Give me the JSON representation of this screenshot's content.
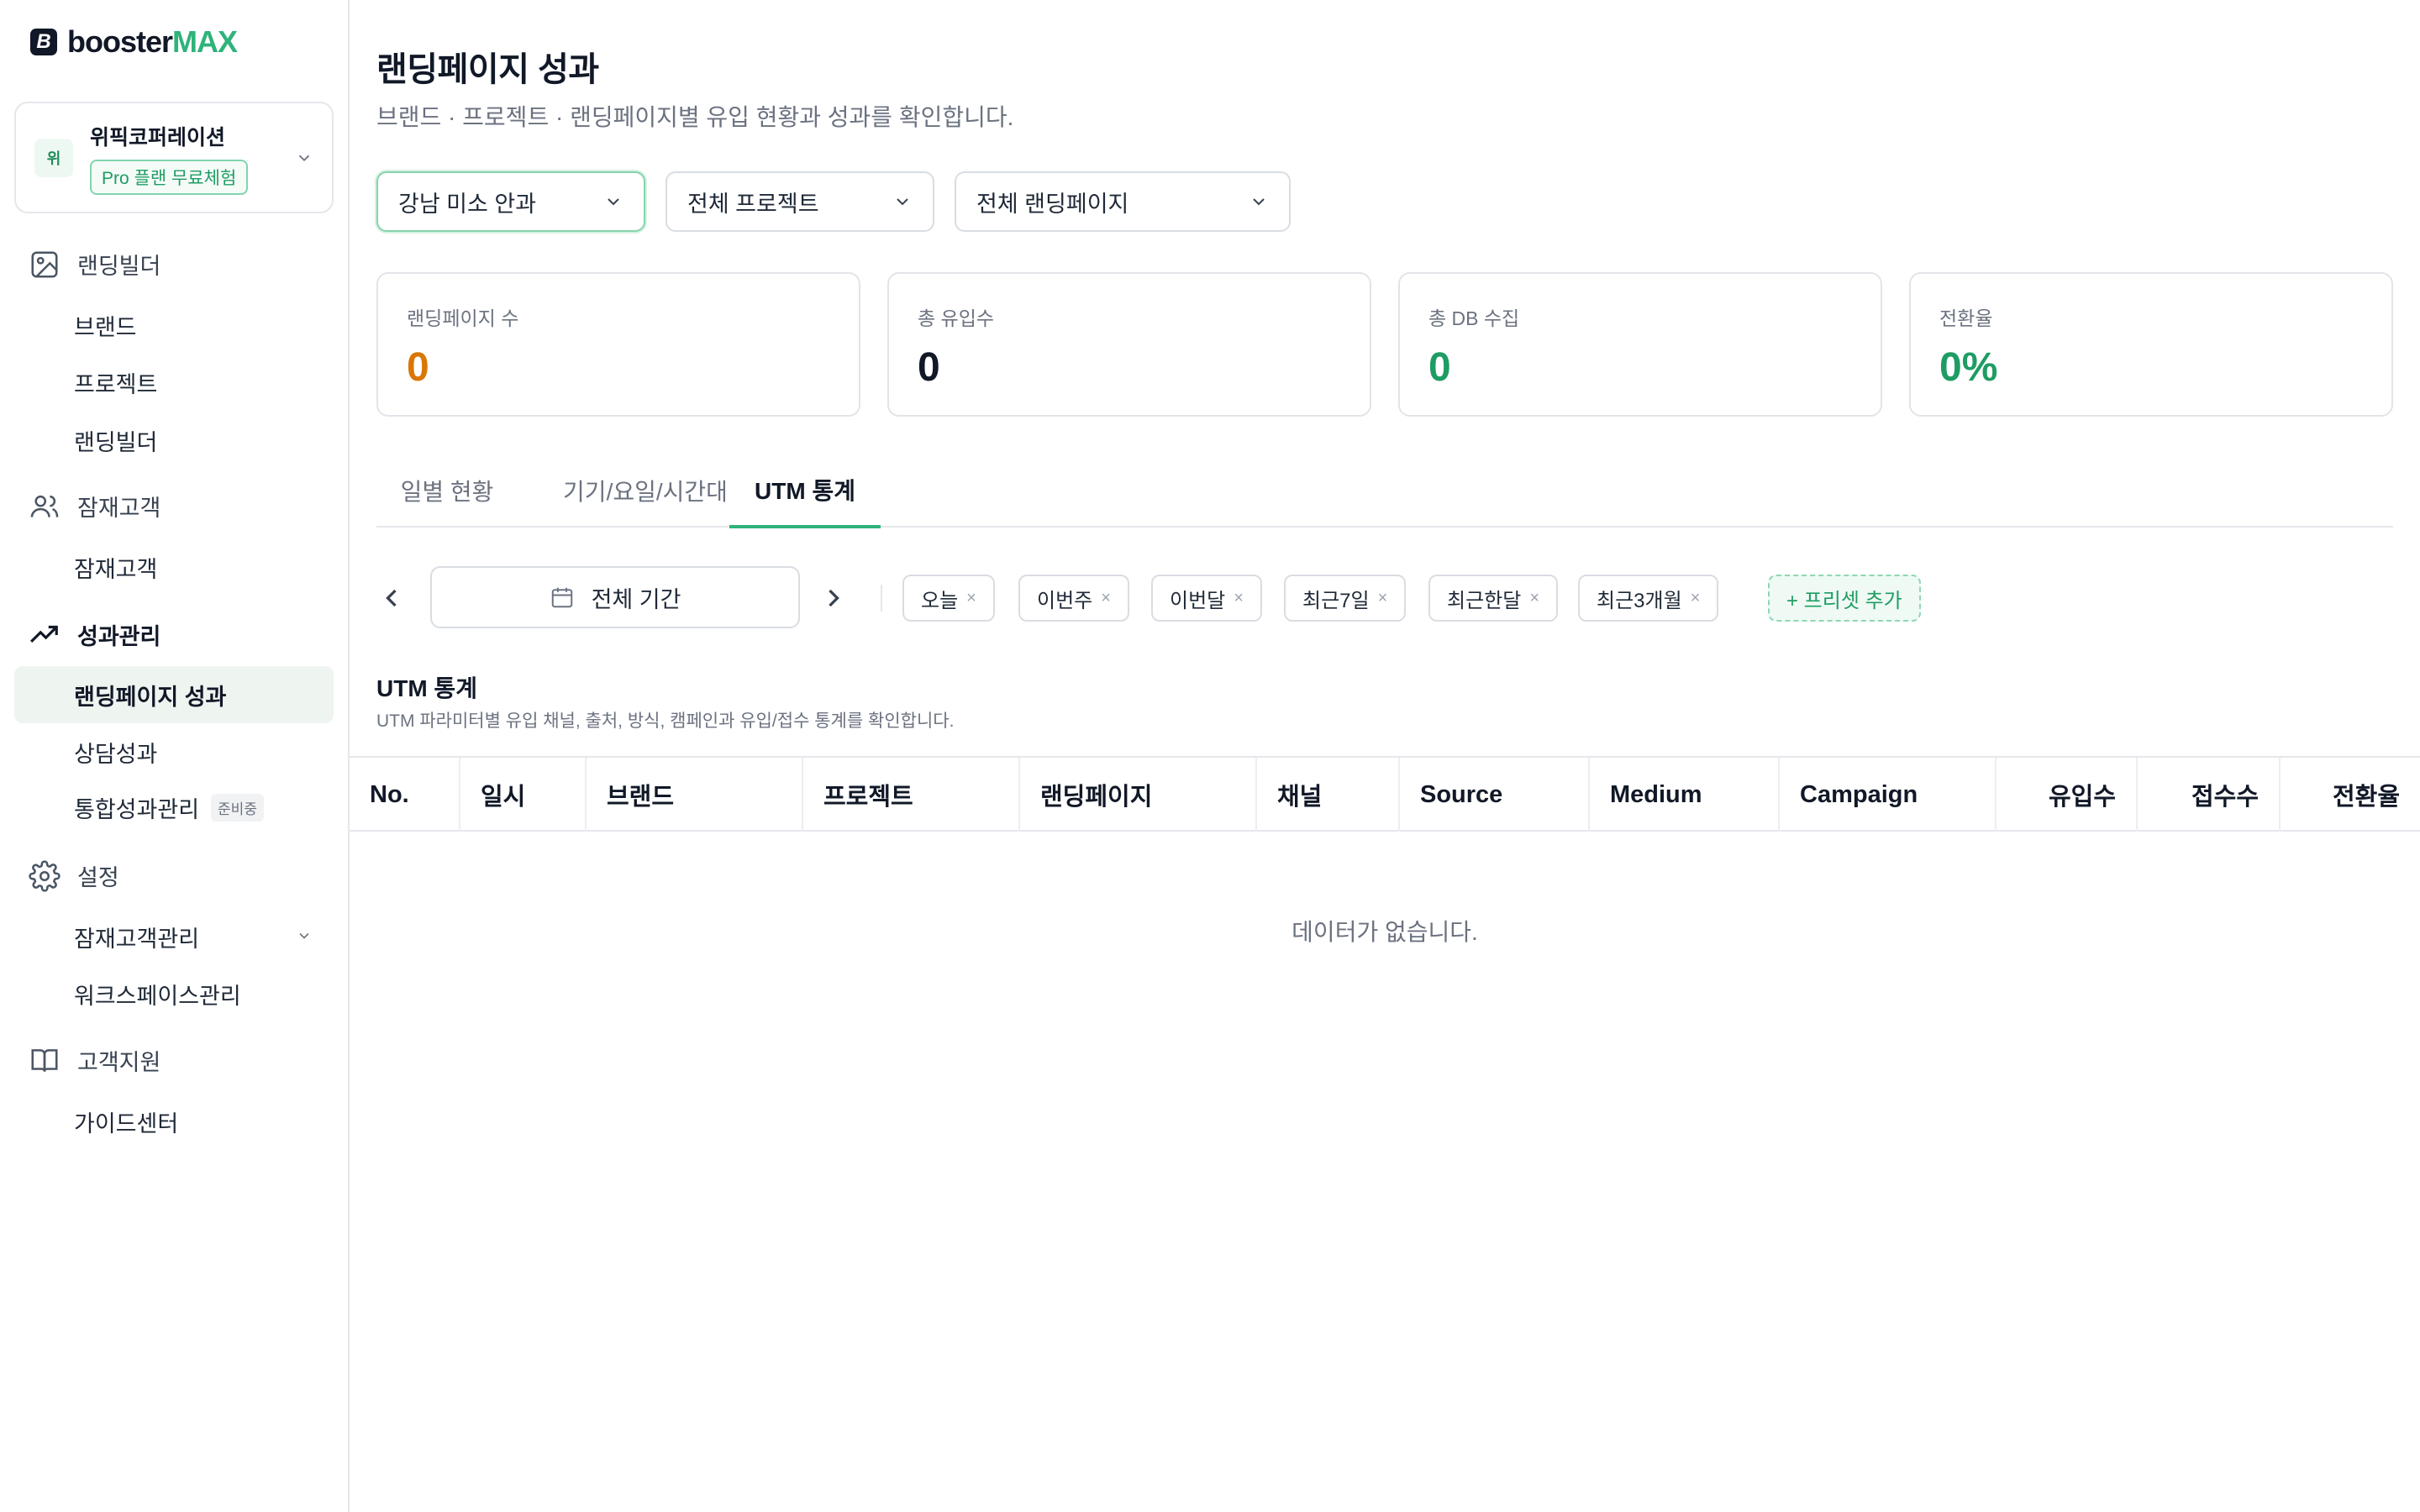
{
  "brand": {
    "logo_text_1": "booster",
    "logo_text_2": "MAX",
    "logo_mark": "B"
  },
  "workspace": {
    "avatar": "위",
    "name": "위픽코퍼레이션",
    "plan": "Pro 플랜 무료체험"
  },
  "sidebar": {
    "sections": [
      {
        "label": "랜딩빌더",
        "icon": "image-icon"
      },
      {
        "label": "잠재고객",
        "icon": "users-icon"
      },
      {
        "label": "성과관리",
        "icon": "trend-icon"
      },
      {
        "label": "설정",
        "icon": "gear-icon"
      },
      {
        "label": "고객지원",
        "icon": "book-icon"
      }
    ],
    "items": {
      "brand": "브랜드",
      "project": "프로젝트",
      "landing_builder": "랜딩빌더",
      "leads": "잠재고객",
      "landing_performance": "랜딩페이지 성과",
      "consult_performance": "상담성과",
      "integrated_performance": "통합성과관리",
      "integrated_badge": "준비중",
      "lead_management": "잠재고객관리",
      "workspace_management": "워크스페이스관리",
      "guide_center": "가이드센터"
    }
  },
  "header": {
    "title": "랜딩페이지 성과",
    "subtitle": "브랜드 · 프로젝트 · 랜딩페이지별 유입 현황과 성과를 확인합니다."
  },
  "filters": {
    "brand": "강남 미소 안과",
    "project": "전체 프로젝트",
    "landing": "전체 랜딩페이지"
  },
  "stats": [
    {
      "label": "랜딩페이지 수",
      "value": "0",
      "color": "#d97706"
    },
    {
      "label": "총 유입수",
      "value": "0",
      "color": "#111827"
    },
    {
      "label": "총 DB 수집",
      "value": "0",
      "color": "#1f9c63"
    },
    {
      "label": "전환율",
      "value": "0%",
      "color": "#1f9c63"
    }
  ],
  "tabs": [
    "일별 현황",
    "기기/요일/시간대",
    "UTM 통계"
  ],
  "active_tab": "UTM 통계",
  "date": {
    "range_label": "전체 기간",
    "presets": [
      "오늘",
      "이번주",
      "이번달",
      "최근7일",
      "최근한달",
      "최근3개월"
    ],
    "add_preset": "+ 프리셋 추가",
    "remove_glyph": "×"
  },
  "utm": {
    "title": "UTM 통계",
    "description": "UTM 파라미터별 유입 채널, 출처, 방식, 캠페인과 유입/접수 통계를 확인합니다.",
    "columns": [
      "No.",
      "일시",
      "브랜드",
      "프로젝트",
      "랜딩페이지",
      "채널",
      "Source",
      "Medium",
      "Campaign",
      "유입수",
      "접수수",
      "전환율"
    ],
    "empty_text": "데이터가 없습니다."
  },
  "colors": {
    "accent": "#2fb37a",
    "border": "#e5e7eb",
    "active_bg": "#eef5f0"
  }
}
